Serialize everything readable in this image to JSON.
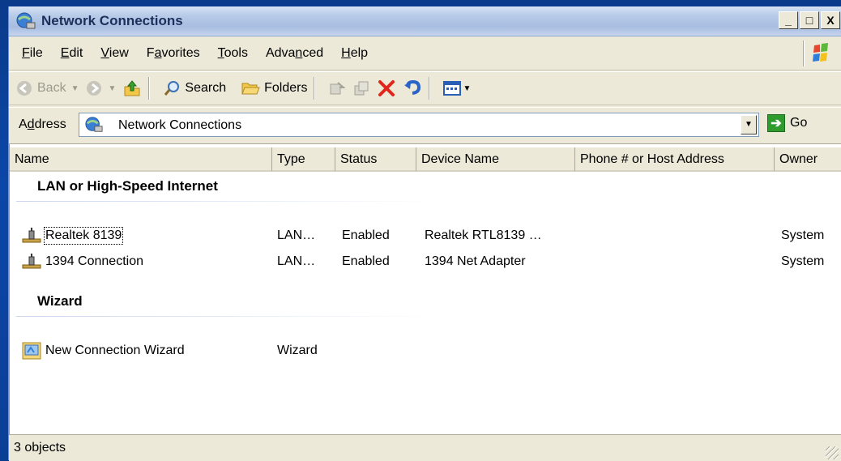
{
  "window": {
    "title": "Network Connections"
  },
  "title_buttons": {
    "minimize": "_",
    "maximize": "□",
    "close": "X"
  },
  "menu": {
    "items": [
      {
        "label_pre": "",
        "accel": "F",
        "label_post": "ile"
      },
      {
        "label_pre": "",
        "accel": "E",
        "label_post": "dit"
      },
      {
        "label_pre": "",
        "accel": "V",
        "label_post": "iew"
      },
      {
        "label_pre": "F",
        "accel": "a",
        "label_post": "vorites"
      },
      {
        "label_pre": "",
        "accel": "T",
        "label_post": "ools"
      },
      {
        "label_pre": "Adva",
        "accel": "n",
        "label_post": "ced"
      },
      {
        "label_pre": "",
        "accel": "H",
        "label_post": "elp"
      }
    ]
  },
  "toolbar": {
    "back_label": "Back",
    "search_label": "Search",
    "folders_label": "Folders"
  },
  "address": {
    "label_pre": "A",
    "accel": "d",
    "label_post": "dress",
    "value": "Network Connections",
    "go_label": "Go"
  },
  "columns": [
    "Name",
    "Type",
    "Status",
    "Device Name",
    "Phone # or Host Address",
    "Owner"
  ],
  "groups": [
    {
      "title": "LAN or High-Speed Internet",
      "rows": [
        {
          "name": "Realtek 8139",
          "type": "LAN…",
          "status": "Enabled",
          "device": "Realtek RTL8139 …",
          "phone": "",
          "owner": "System",
          "icon": "lan-connection-icon"
        },
        {
          "name": "1394 Connection",
          "type": "LAN…",
          "status": "Enabled",
          "device": "1394 Net Adapter",
          "phone": "",
          "owner": "System",
          "icon": "lan-connection-icon"
        }
      ]
    },
    {
      "title": "Wizard",
      "rows": [
        {
          "name": "New Connection Wizard",
          "type": "Wizard",
          "status": "",
          "device": "",
          "phone": "",
          "owner": "",
          "icon": "wizard-icon"
        }
      ]
    }
  ],
  "status": {
    "text": "3 objects"
  },
  "colors": {
    "desktop": "#0b47a8",
    "chrome": "#ece9d8",
    "delete_red": "#e0261b"
  }
}
